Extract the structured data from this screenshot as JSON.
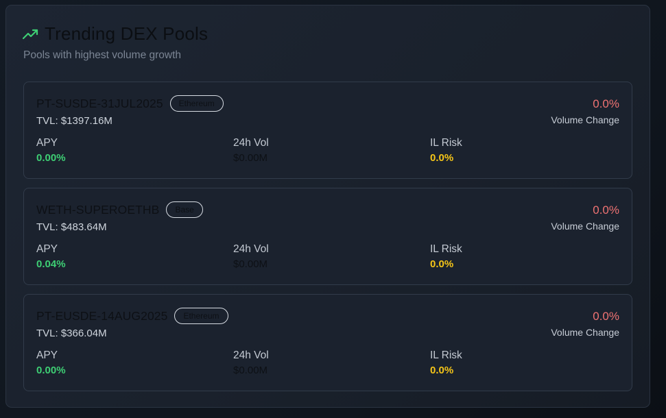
{
  "header": {
    "title": "Trending DEX Pools",
    "subtitle": "Pools with highest volume growth",
    "icon": "trending-up-icon",
    "icon_color": "#3ecf74"
  },
  "labels": {
    "apy": "APY",
    "volume_24h": "24h Vol",
    "il_risk": "IL Risk",
    "volume_change": "Volume Change"
  },
  "colors": {
    "apy": "#3ecf74",
    "il_risk": "#f5c518",
    "volume_change": "#f07373"
  },
  "pools": [
    {
      "name": "PT-SUSDE-31JUL2025",
      "chain": "Ethereum",
      "tvl": "TVL: $1397.16M",
      "volume_change": "0.0%",
      "apy": "0.00%",
      "volume_24h": "$0.00M",
      "il_risk": "0.0%"
    },
    {
      "name": "WETH-SUPEROETHB",
      "chain": "Base",
      "tvl": "TVL: $483.64M",
      "volume_change": "0.0%",
      "apy": "0.04%",
      "volume_24h": "$0.00M",
      "il_risk": "0.0%"
    },
    {
      "name": "PT-EUSDE-14AUG2025",
      "chain": "Ethereum",
      "tvl": "TVL: $366.04M",
      "volume_change": "0.0%",
      "apy": "0.00%",
      "volume_24h": "$0.00M",
      "il_risk": "0.0%"
    }
  ]
}
